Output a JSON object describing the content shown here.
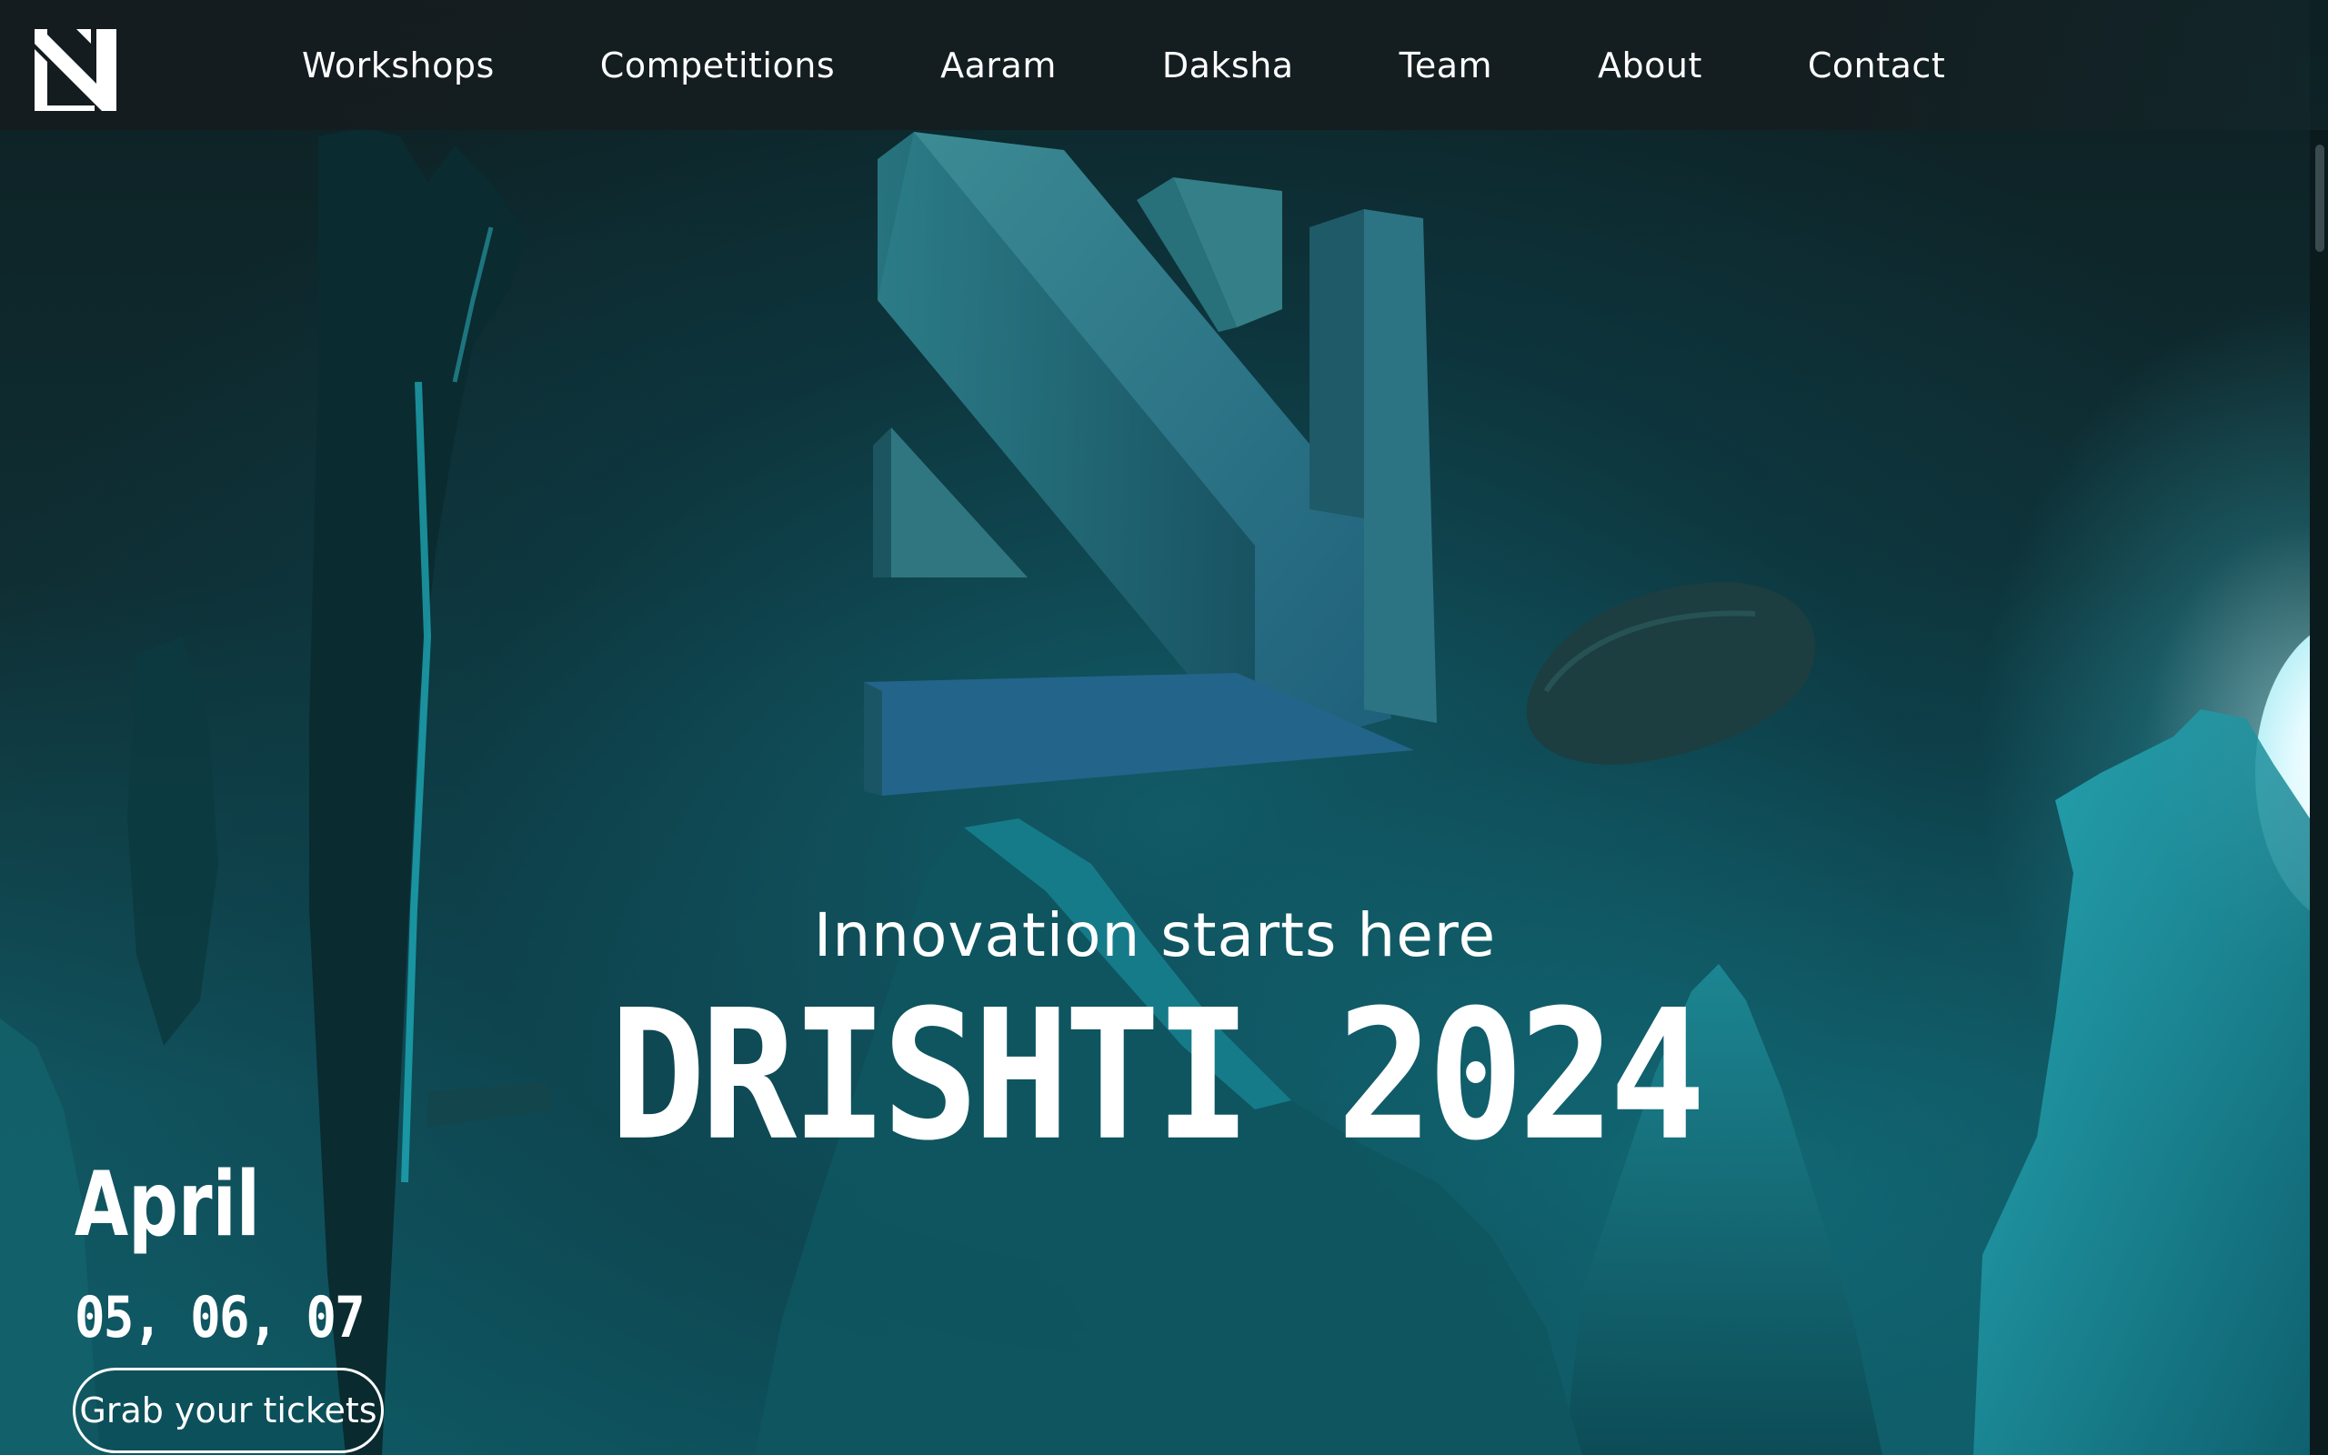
{
  "nav": {
    "logo_icon": "drishti-logo-icon",
    "links": [
      "Workshops",
      "Competitions",
      "Aaram",
      "Daksha",
      "Team",
      "About",
      "Contact"
    ]
  },
  "hero": {
    "tagline": "Innovation starts here",
    "title": "DRISHTI 2024",
    "date_month": "April",
    "date_days": "05, 06, 07",
    "cta_label": "Grab your tickets",
    "hero_icon": "drishti-3d-logo-icon"
  },
  "colors": {
    "accent": "#1fa3b2",
    "nav_bg": "#141c1f",
    "text": "#ffffff"
  }
}
